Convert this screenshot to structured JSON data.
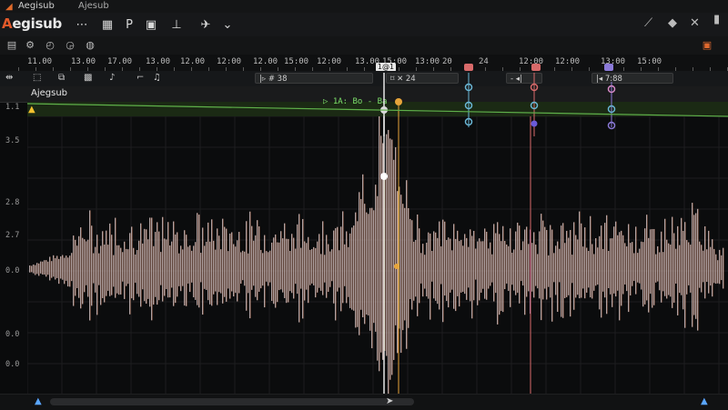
{
  "window": {
    "title": "Aegisub",
    "subtitle": "Ajesub"
  },
  "toolbar": {
    "brand_prefix": "A",
    "brand_rest": "egisub",
    "icons": [
      "grid-icon",
      "dots-icon",
      "text-p-icon",
      "image-icon",
      "baseline-icon",
      "plane-icon",
      "chevron-down-icon"
    ],
    "right_icons": [
      "link-icon",
      "tag-icon",
      "settings-icon",
      "bookmark-icon",
      "gear-icon"
    ]
  },
  "timeline": {
    "labels": [
      "11.00",
      "13.00",
      "17.00",
      "13.00",
      "12.00",
      "12:00",
      "12.00",
      "15:00",
      "12:00",
      "13.00",
      "15:00",
      "13:00",
      "20",
      "24",
      "12:00",
      "12:00",
      "13:00",
      "15:00"
    ],
    "playhead_label": "1@1"
  },
  "controls": {
    "field1": "|▹  # 38",
    "field2": "⌑  ✕ 24",
    "field3": "- ◂|",
    "field4": "|◂   7:88"
  },
  "track": {
    "name": "Ajegsub",
    "time_left": "1.1"
  },
  "lane": {
    "label": "▷ 1A: Bo - Ba"
  },
  "yaxis": {
    "labels": [
      "1.1",
      "3.5",
      "2.8",
      "2.7",
      "0.0",
      "0.0",
      "0.0"
    ]
  },
  "colors": {
    "playhead": "#e6e6e6",
    "marker_orange": "#e7a53a",
    "marker_red": "#d86a6a",
    "marker_blue": "#6ab7d6",
    "marker_purple": "#8b7ad8",
    "lane_green": "#7de06a"
  }
}
